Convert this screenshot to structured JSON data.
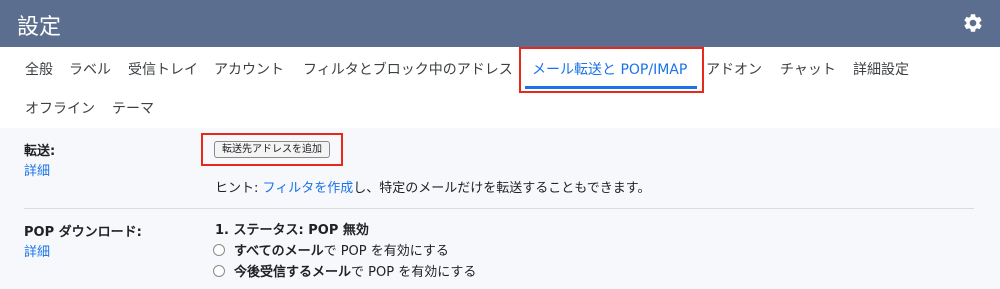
{
  "header": {
    "title": "設定",
    "settings_icon": "gear-icon"
  },
  "tabs": {
    "row1": [
      {
        "label": "全般"
      },
      {
        "label": "ラベル"
      },
      {
        "label": "受信トレイ"
      },
      {
        "label": "アカウント"
      },
      {
        "label": "フィルタとブロック中のアドレス"
      },
      {
        "label": "メール転送と POP/IMAP",
        "active": true
      },
      {
        "label": "アドオン"
      },
      {
        "label": "チャット"
      },
      {
        "label": "詳細設定"
      }
    ],
    "row2": [
      {
        "label": "オフライン"
      },
      {
        "label": "テーマ"
      }
    ]
  },
  "forwarding": {
    "label": "転送:",
    "details_link": "詳細",
    "add_button": "転送先アドレスを追加",
    "hint_prefix": "ヒント: ",
    "hint_link": "フィルタを作成",
    "hint_suffix": "し、特定のメールだけを転送することもできます。"
  },
  "pop": {
    "label": "POP ダウンロード:",
    "details_link": "詳細",
    "status": "1. ステータス: POP 無効",
    "options": [
      {
        "bold": "すべてのメール",
        "rest": "で POP を有効にする"
      },
      {
        "bold": "今後受信するメール",
        "rest": "で POP を有効にする"
      }
    ]
  },
  "colors": {
    "header_bg": "#5c6e8f",
    "accent": "#1a73e8",
    "highlight": "#e8281b",
    "content_bg": "#f6f8fc"
  }
}
